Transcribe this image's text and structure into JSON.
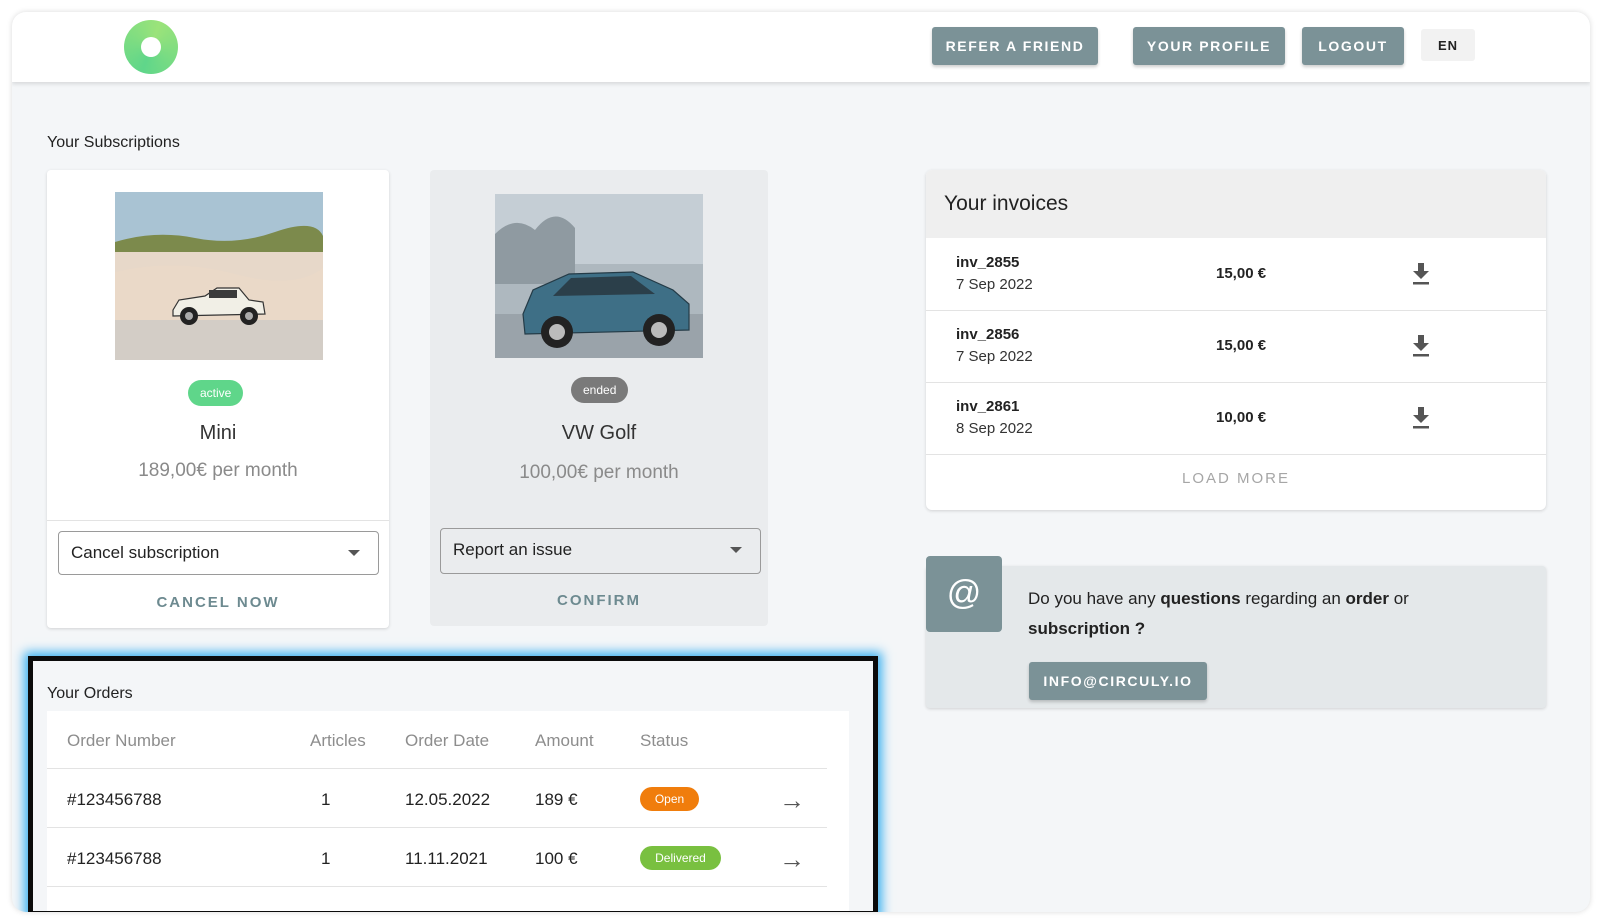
{
  "nav": {
    "refer": "REFER A FRIEND",
    "profile": "YOUR PROFILE",
    "logout": "LOGOUT",
    "language": "EN"
  },
  "subscriptions": {
    "title": "Your Subscriptions",
    "items": [
      {
        "status": "active",
        "status_color": "#5fd68a",
        "name": "Mini",
        "price": "189,00€ per month",
        "action_select": "Cancel subscription",
        "action_button": "CANCEL NOW"
      },
      {
        "status": "ended",
        "status_color": "#7a7a7a",
        "name": "VW Golf",
        "price": "100,00€ per month",
        "action_select": "Report an issue",
        "action_button": "CONFIRM"
      }
    ]
  },
  "orders": {
    "title": "Your Orders",
    "columns": [
      "Order Number",
      "Articles",
      "Order Date",
      "Amount",
      "Status"
    ],
    "rows": [
      {
        "number": "#123456788",
        "articles": "1",
        "date": "12.05.2022",
        "amount": "189 €",
        "status": "Open",
        "status_color": "#f07d0c"
      },
      {
        "number": "#123456788",
        "articles": "1",
        "date": "11.11.2021",
        "amount": "100 €",
        "status": "Delivered",
        "status_color": "#79c040"
      }
    ]
  },
  "invoices": {
    "title": "Your invoices",
    "items": [
      {
        "id": "inv_2855",
        "date": "7 Sep 2022",
        "amount": "15,00 €"
      },
      {
        "id": "inv_2856",
        "date": "7 Sep 2022",
        "amount": "15,00 €"
      },
      {
        "id": "inv_2861",
        "date": "8 Sep 2022",
        "amount": "10,00 €"
      }
    ],
    "load_more": "LOAD MORE"
  },
  "contact": {
    "text_1": "Do you have any ",
    "text_2": "questions",
    "text_3": " regarding an ",
    "text_4": "order",
    "text_5": " or ",
    "text_6": "subscription ?",
    "email_button": "INFO@CIRCULY.IO",
    "icon": "at-icon"
  },
  "colors": {
    "accent": "#7b9297",
    "background": "#f4f6f8",
    "highlight_glow": "#3fb2f0"
  }
}
